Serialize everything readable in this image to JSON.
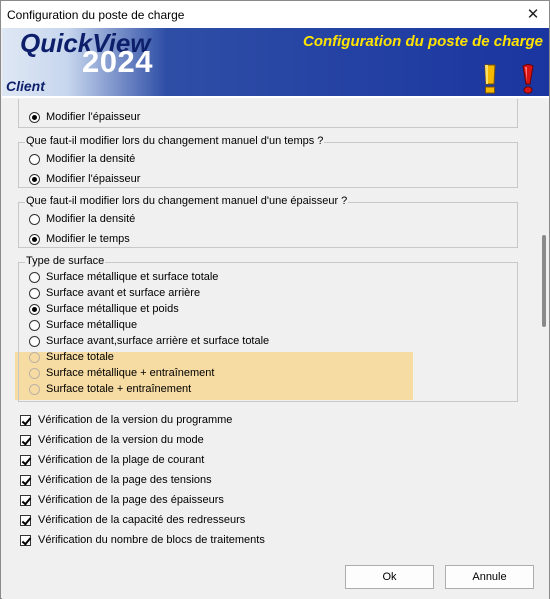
{
  "window": {
    "title": "Configuration du poste de charge",
    "close_glyph": "✕"
  },
  "banner": {
    "brand": "QuickView",
    "year": "2024",
    "client": "Client",
    "subtitle": "Configuration du poste de charge",
    "icons": [
      "warning-exclamation-icon",
      "alert-exclamation-icon"
    ],
    "colors": {
      "subtitle": "#ffe300",
      "brand": "#0d1f6b",
      "gradient_dark": "#1a35a0"
    }
  },
  "group_top_partial": {
    "options": [
      {
        "label": "Modifier l'épaisseur",
        "checked": true
      }
    ]
  },
  "group_time": {
    "caption": "Que faut-il modifier lors du changement manuel d'un temps ?",
    "options": [
      {
        "label": "Modifier la densité",
        "checked": false
      },
      {
        "label": "Modifier l'épaisseur",
        "checked": true
      }
    ]
  },
  "group_thickness": {
    "caption": "Que faut-il modifier lors du changement manuel d'une épaisseur ?",
    "options": [
      {
        "label": "Modifier la densité",
        "checked": false
      },
      {
        "label": "Modifier le temps",
        "checked": true
      }
    ]
  },
  "group_surface": {
    "caption": "Type de surface",
    "options": [
      {
        "label": "Surface métallique et surface totale",
        "checked": false
      },
      {
        "label": "Surface avant et surface arrière",
        "checked": false
      },
      {
        "label": "Surface métallique et poids",
        "checked": true
      },
      {
        "label": "Surface métallique",
        "checked": false
      },
      {
        "label": "Surface avant,surface arrière et surface totale",
        "checked": false
      },
      {
        "label": "Surface totale",
        "checked": false
      },
      {
        "label": "Surface métallique + entraînement",
        "checked": false
      },
      {
        "label": "Surface totale + entraînement",
        "checked": false
      }
    ],
    "highlight_color": "#f6dba3"
  },
  "checks": [
    {
      "label": "Vérification de la version du programme",
      "checked": true
    },
    {
      "label": "Vérification de la version du mode",
      "checked": true
    },
    {
      "label": "Vérification de la plage de courant",
      "checked": true
    },
    {
      "label": "Vérification de la page des tensions",
      "checked": true
    },
    {
      "label": "Vérification de la page des épaisseurs",
      "checked": true
    },
    {
      "label": "Vérification de la capacité des redresseurs",
      "checked": true
    },
    {
      "label": "Vérification du nombre de blocs de traitements",
      "checked": true
    }
  ],
  "footer": {
    "ok_label": "Ok",
    "cancel_label": "Annule"
  }
}
